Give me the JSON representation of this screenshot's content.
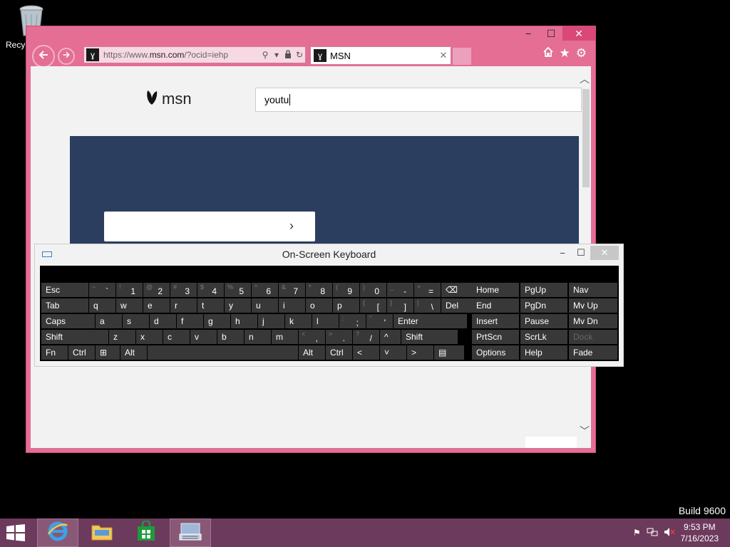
{
  "desktop": {
    "recycle_label": "Recyc",
    "build": "Build 9600"
  },
  "ie": {
    "address": "https://www.msn.com/?ocid=iehp",
    "address_host_prefix": "https://www.",
    "address_host": "msn.com",
    "address_path": "/?ocid=iehp",
    "tab_title": "MSN",
    "caption": {
      "min": "−",
      "max": "☐",
      "close": "✕"
    },
    "tab_close": "✕"
  },
  "page": {
    "logo_text": "msn",
    "search_value": "youtu"
  },
  "osk": {
    "title": "On-Screen Keyboard",
    "rows": [
      [
        {
          "label": "Esc",
          "w": 66
        },
        {
          "shift": "~",
          "main": "`",
          "w": 37
        },
        {
          "shift": "!",
          "main": "1",
          "w": 37
        },
        {
          "shift": "@",
          "main": "2",
          "w": 37
        },
        {
          "shift": "#",
          "main": "3",
          "w": 37
        },
        {
          "shift": "$",
          "main": "4",
          "w": 37
        },
        {
          "shift": "%",
          "main": "5",
          "w": 37
        },
        {
          "shift": "^",
          "main": "6",
          "w": 37
        },
        {
          "shift": "&",
          "main": "7",
          "w": 37
        },
        {
          "shift": "*",
          "main": "8",
          "w": 37
        },
        {
          "shift": "(",
          "main": "9",
          "w": 37
        },
        {
          "shift": ")",
          "main": "0",
          "w": 37
        },
        {
          "shift": "_",
          "main": "-",
          "w": 37
        },
        {
          "shift": "+",
          "main": "=",
          "w": 37
        },
        {
          "label": "⌫",
          "w": 68
        }
      ],
      [
        {
          "label": "Tab",
          "w": 66
        },
        {
          "label": "q",
          "w": 37
        },
        {
          "label": "w",
          "w": 37
        },
        {
          "label": "e",
          "w": 37
        },
        {
          "label": "r",
          "w": 37
        },
        {
          "label": "t",
          "w": 37
        },
        {
          "label": "y",
          "w": 37
        },
        {
          "label": "u",
          "w": 37
        },
        {
          "label": "i",
          "w": 37
        },
        {
          "label": "o",
          "w": 37
        },
        {
          "label": "p",
          "w": 37
        },
        {
          "shift": "{",
          "main": "[",
          "w": 37
        },
        {
          "shift": "}",
          "main": "]",
          "w": 37
        },
        {
          "shift": "|",
          "main": "\\",
          "w": 37
        },
        {
          "label": "Del",
          "w": 68
        }
      ],
      [
        {
          "label": "Caps",
          "w": 75
        },
        {
          "label": "a",
          "w": 37
        },
        {
          "label": "s",
          "w": 37
        },
        {
          "label": "d",
          "w": 37
        },
        {
          "label": "f",
          "w": 37
        },
        {
          "label": "g",
          "w": 37
        },
        {
          "label": "h",
          "w": 37
        },
        {
          "label": "j",
          "w": 37
        },
        {
          "label": "k",
          "w": 37
        },
        {
          "label": "l",
          "w": 37
        },
        {
          "shift": ":",
          "main": ";",
          "w": 37
        },
        {
          "shift": "\"",
          "main": "'",
          "w": 37
        },
        {
          "label": "Enter",
          "w": 103
        }
      ],
      [
        {
          "label": "Shift",
          "w": 94
        },
        {
          "label": "z",
          "w": 37
        },
        {
          "label": "x",
          "w": 37
        },
        {
          "label": "c",
          "w": 37
        },
        {
          "label": "v",
          "w": 37
        },
        {
          "label": "b",
          "w": 37
        },
        {
          "label": "n",
          "w": 37
        },
        {
          "label": "m",
          "w": 37
        },
        {
          "shift": "<",
          "main": ",",
          "w": 37
        },
        {
          "shift": ">",
          "main": ".",
          "w": 37
        },
        {
          "shift": "?",
          "main": "/",
          "w": 37
        },
        {
          "label": "^",
          "w": 29
        },
        {
          "label": "Shift",
          "w": 79
        }
      ],
      [
        {
          "label": "Fn",
          "w": 37
        },
        {
          "label": "Ctrl",
          "w": 37
        },
        {
          "label": "⊞",
          "w": 34
        },
        {
          "label": "Alt",
          "w": 37
        },
        {
          "label": "",
          "w": 211
        },
        {
          "label": "Alt",
          "w": 37
        },
        {
          "label": "Ctrl",
          "w": 37
        },
        {
          "label": "<",
          "w": 37
        },
        {
          "label": "˅",
          "w": 37
        },
        {
          "label": ">",
          "w": 37
        },
        {
          "label": "▤",
          "w": 42
        }
      ]
    ],
    "nav": [
      [
        "Home",
        "PgUp",
        "Nav"
      ],
      [
        "End",
        "PgDn",
        "Mv Up"
      ],
      [
        "Insert",
        "Pause",
        "Mv Dn"
      ],
      [
        "PrtScn",
        "ScrLk",
        "Dock"
      ],
      [
        "Options",
        "Help",
        "Fade"
      ]
    ]
  },
  "taskbar": {
    "time": "9:53 PM",
    "date": "7/16/2023"
  },
  "colors": {
    "ie_frame": "#e46e94",
    "taskbar": "#6c3a5c",
    "banner": "#2c3e5f",
    "key": "#383838"
  }
}
